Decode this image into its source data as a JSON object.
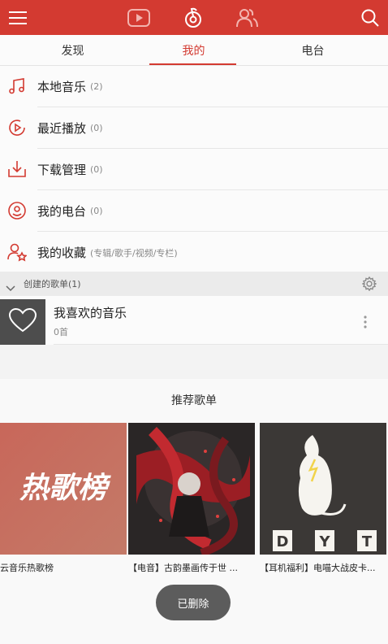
{
  "topbar": {
    "accent_color": "#d33a31",
    "icons": [
      "menu-icon",
      "video-icon",
      "music-icon",
      "friends-icon",
      "search-icon"
    ]
  },
  "tabs": [
    {
      "label": "发现",
      "active": false
    },
    {
      "label": "我的",
      "active": true
    },
    {
      "label": "电台",
      "active": false
    }
  ],
  "menu": [
    {
      "label": "本地音乐",
      "count": "(2)",
      "icon": "music-note-icon"
    },
    {
      "label": "最近播放",
      "count": "(0)",
      "icon": "recent-play-icon"
    },
    {
      "label": "下载管理",
      "count": "(0)",
      "icon": "download-icon"
    },
    {
      "label": "我的电台",
      "count": "(0)",
      "icon": "radio-icon"
    },
    {
      "label": "我的收藏",
      "count": "(专辑/歌手/视频/专栏)",
      "icon": "collection-icon"
    }
  ],
  "created_section": {
    "label": "创建的歌单(1)"
  },
  "playlist": {
    "title": "我喜欢的音乐",
    "count": "0首"
  },
  "recommend": {
    "title": "推荐歌单",
    "cards": [
      {
        "caption": "云音乐热歌榜",
        "cover_text": "热歌榜"
      },
      {
        "caption": "【电音】古韵墨画传于世 ..."
      },
      {
        "caption": "【耳机福利】电喵大战皮卡...",
        "cover_letters": [
          "D",
          "Y",
          "T"
        ]
      }
    ]
  },
  "toast": {
    "text": "已删除"
  }
}
